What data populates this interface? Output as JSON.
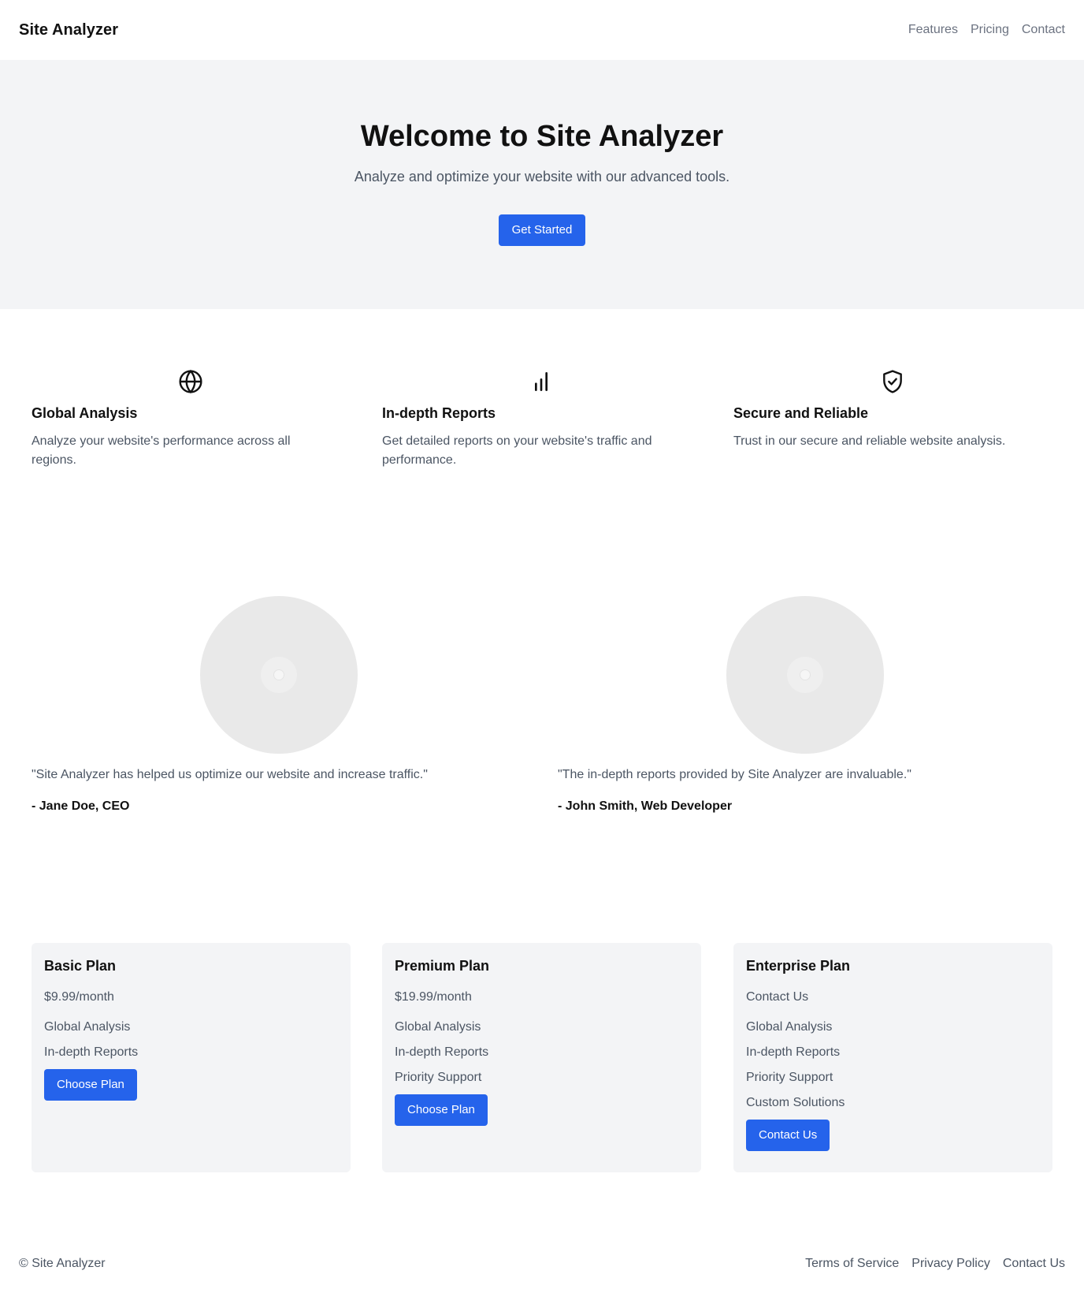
{
  "header": {
    "brand": "Site Analyzer",
    "nav": [
      "Features",
      "Pricing",
      "Contact"
    ]
  },
  "hero": {
    "title": "Welcome to Site Analyzer",
    "subtitle": "Analyze and optimize your website with our advanced tools.",
    "cta": "Get Started"
  },
  "features": [
    {
      "icon": "globe-icon",
      "title": "Global Analysis",
      "text": "Analyze your website's performance across all regions."
    },
    {
      "icon": "bar-chart-icon",
      "title": "In-depth Reports",
      "text": "Get detailed reports on your website's traffic and performance."
    },
    {
      "icon": "shield-check-icon",
      "title": "Secure and Reliable",
      "text": "Trust in our secure and reliable website analysis."
    }
  ],
  "testimonials": [
    {
      "quote": "\"Site Analyzer has helped us optimize our website and increase traffic.\"",
      "author": "- Jane Doe, CEO"
    },
    {
      "quote": "\"The in-depth reports provided by Site Analyzer are invaluable.\"",
      "author": "- John Smith, Web Developer"
    }
  ],
  "plans": [
    {
      "name": "Basic Plan",
      "price": "$9.99/month",
      "features": [
        "Global Analysis",
        "In-depth Reports"
      ],
      "button": "Choose Plan"
    },
    {
      "name": "Premium Plan",
      "price": "$19.99/month",
      "features": [
        "Global Analysis",
        "In-depth Reports",
        "Priority Support"
      ],
      "button": "Choose Plan"
    },
    {
      "name": "Enterprise Plan",
      "price": "Contact Us",
      "features": [
        "Global Analysis",
        "In-depth Reports",
        "Priority Support",
        "Custom Solutions"
      ],
      "button": "Contact Us"
    }
  ],
  "footer": {
    "copyright": "© Site Analyzer",
    "links": [
      "Terms of Service",
      "Privacy Policy",
      "Contact Us"
    ]
  },
  "colors": {
    "accent": "#2563eb",
    "hero_bg": "#f3f4f6",
    "card_bg": "#f3f4f6",
    "muted_text": "#4b5563"
  }
}
